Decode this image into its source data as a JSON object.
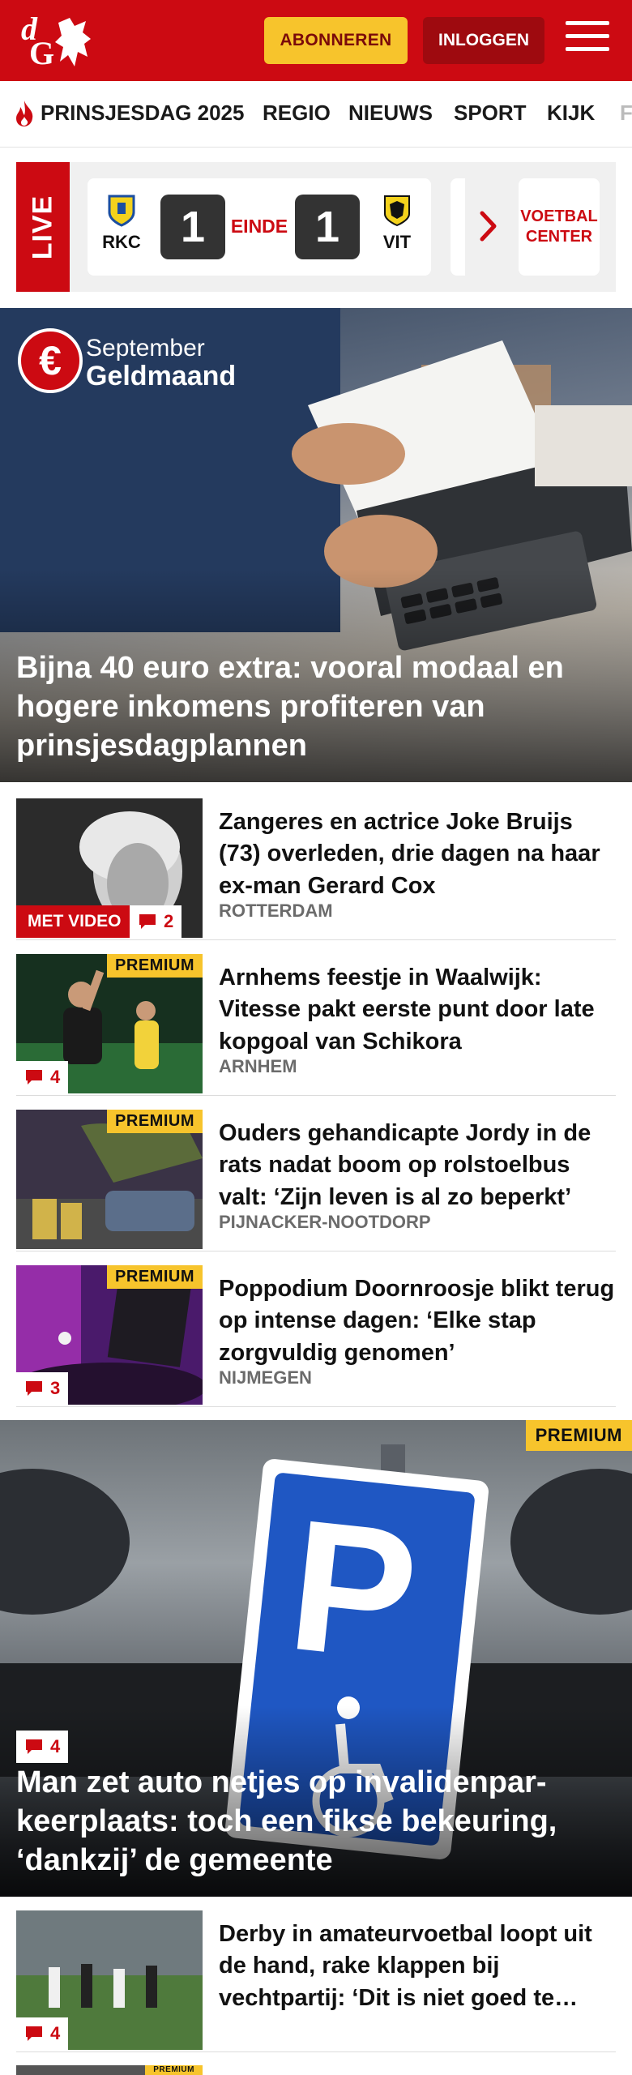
{
  "header": {
    "logo_text_top": "d",
    "logo_text_bottom": "G",
    "subscribe_label": "ABONNEREN",
    "login_label": "INLOGGEN",
    "brand_color": "#cc0a12"
  },
  "nav": {
    "items": [
      {
        "label": "PRINSJESDAG 2025",
        "icon": "flame-icon"
      },
      {
        "label": "REGIO"
      },
      {
        "label": "NIEUWS"
      },
      {
        "label": "SPORT"
      },
      {
        "label": "KIJK"
      },
      {
        "label": "F"
      }
    ]
  },
  "live": {
    "tag": "LIVE",
    "match": {
      "home": "RKC",
      "away": "VIT",
      "home_score": "1",
      "away_score": "1",
      "status": "EINDE"
    },
    "cta": "VOETBAL CENTER"
  },
  "hero": {
    "badge_month": "September",
    "badge_name": "Geldmaand",
    "badge_symbol": "€",
    "title": "Bijna 40 euro extra: vooral modaal en hogere inkomens profiteren van prinsjesdagplannen"
  },
  "articles": [
    {
      "title": "Zangeres en actrice Joke Bruijs (73) overleden, drie dagen na haar ex-man Gerard Cox",
      "location": "ROTTERDAM",
      "video_label": "MET VIDEO",
      "comments": "2"
    },
    {
      "title": "Arnhems feestje in Waalwijk: Vitesse pakt eerste punt door late kopgoal van Schikora",
      "location": "ARNHEM",
      "premium": "PREMIUM",
      "comments": "4"
    },
    {
      "title": "Ouders gehandicapte Jordy in de rats nadat boom op rolstoelbus valt: ‘Zijn leven is al zo beperkt’",
      "location": "PIJNACKER-NOOTDORP",
      "premium": "PREMIUM"
    },
    {
      "title": "Poppodium Doornroosje blikt terug op intense dagen: ‘Elke stap zorgvuldig genomen’",
      "location": "NIJMEGEN",
      "premium": "PREMIUM",
      "comments": "3"
    }
  ],
  "feature": {
    "premium": "PREMIUM",
    "comments": "4",
    "title": "Man zet auto netjes op invalidenpar­keerplaats: toch een fikse bekeuring, ‘dankzij’ de gemeente"
  },
  "articles_bottom": [
    {
      "title": "Derby in amateurvoetbal loopt uit de hand, rake klappen bij vechtpartij: ‘Dit is niet goed te…",
      "comments": "4"
    },
    {
      "title": "",
      "premium": "PREMIUM"
    }
  ]
}
